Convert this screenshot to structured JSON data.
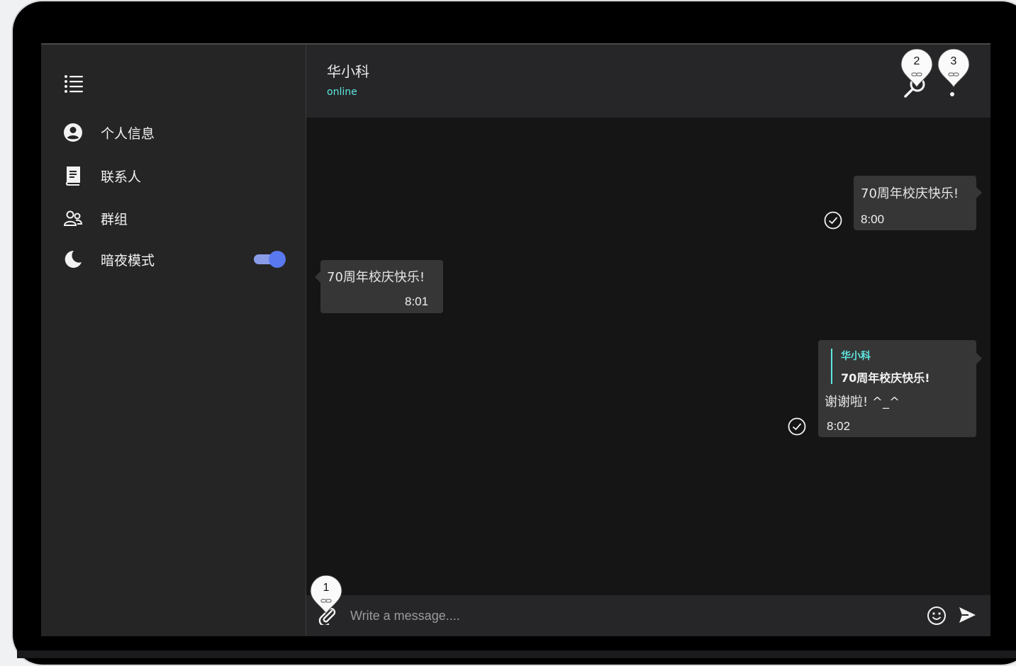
{
  "sidebar": {
    "menu_icon": "list-icon",
    "items": [
      {
        "label": "个人信息",
        "icon": "user-circle-icon"
      },
      {
        "label": "联系人",
        "icon": "contacts-book-icon"
      },
      {
        "label": "群组",
        "icon": "group-icon"
      },
      {
        "label": "暗夜模式",
        "icon": "moon-icon"
      }
    ],
    "dark_mode_enabled": true
  },
  "header": {
    "contact_name": "华小科",
    "status": "online",
    "buttons": [
      "search-icon",
      "more-vertical-icon"
    ]
  },
  "markers": [
    "1",
    "2",
    "3"
  ],
  "messages": [
    {
      "direction": "out",
      "text": "70周年校庆快乐!",
      "time": "8:00",
      "read": true
    },
    {
      "direction": "in",
      "text": "70周年校庆快乐!",
      "time": "8:01"
    },
    {
      "direction": "out",
      "quote_name": "华小科",
      "quote_text": "70周年校庆快乐!",
      "text": "谢谢啦! ^_^",
      "time": "8:02",
      "read": true
    }
  ],
  "composer": {
    "placeholder": "Write a message....",
    "icons": [
      "paperclip-icon",
      "emoji-icon",
      "send-icon"
    ]
  },
  "colors": {
    "accent": "#5ee6e0",
    "toggle": "#5a78f0",
    "sidebar_bg": "#252525",
    "chat_bg": "#151515",
    "bubble_bg": "#363636"
  }
}
